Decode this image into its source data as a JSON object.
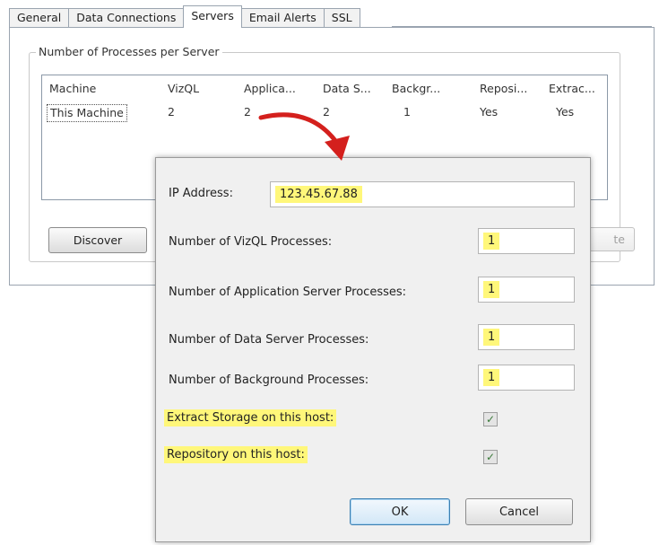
{
  "tabs": [
    {
      "label": "General"
    },
    {
      "label": "Data Connections"
    },
    {
      "label": "Servers"
    },
    {
      "label": "Email Alerts"
    },
    {
      "label": "SSL"
    }
  ],
  "active_tab": "Servers",
  "group_title": "Number of Processes per Server",
  "table": {
    "columns": [
      "Machine",
      "VizQL",
      "Applica...",
      "Data S...",
      "Backgr...",
      "Reposi...",
      "Extrac..."
    ],
    "rows": [
      [
        "This Machine",
        "2",
        "2",
        "2",
        "1",
        "Yes",
        "Yes"
      ]
    ]
  },
  "buttons": {
    "discover": "Discover",
    "hidden_partial": "te"
  },
  "dialog": {
    "ip_label": "IP Address:",
    "ip_value": "123.45.67.88",
    "vizql_label": "Number of VizQL Processes:",
    "vizql_value": "1",
    "app_label": "Number of Application Server Processes:",
    "app_value": "1",
    "data_label": "Number of Data Server Processes:",
    "data_value": "1",
    "bg_label": "Number of Background Processes:",
    "bg_value": "1",
    "extract_label": "Extract Storage on this host:",
    "extract_checked": true,
    "repo_label": "Repository on this host:",
    "repo_checked": true,
    "ok_label": "OK",
    "cancel_label": "Cancel"
  },
  "colors": {
    "highlight": "#fff77a",
    "arrow": "#d4201d"
  }
}
